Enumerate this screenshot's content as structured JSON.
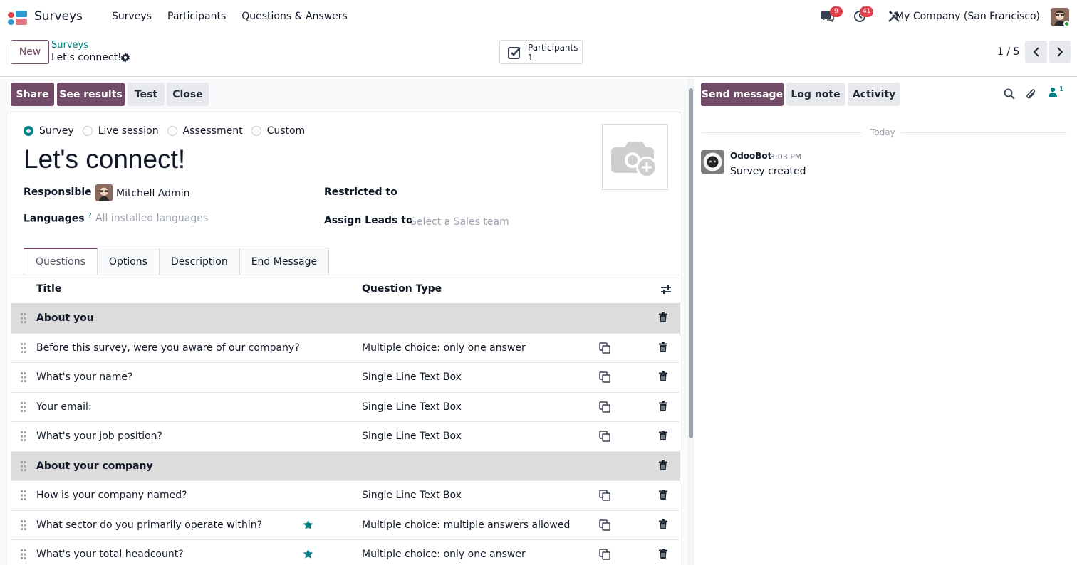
{
  "navbar": {
    "app_title": "Surveys",
    "menu": [
      "Surveys",
      "Participants",
      "Questions & Answers"
    ],
    "messages_count": "9",
    "activities_count": "41",
    "company": "My Company (San Francisco)"
  },
  "control": {
    "new_label": "New",
    "breadcrumb_parent": "Surveys",
    "breadcrumb_current": "Let's connect!",
    "smart_button": {
      "label": "Participants",
      "value": "1"
    },
    "pager": "1 / 5"
  },
  "header_buttons": {
    "share": "Share",
    "see_results": "See results",
    "test": "Test",
    "close": "Close"
  },
  "form": {
    "survey_types": [
      "Survey",
      "Live session",
      "Assessment",
      "Custom"
    ],
    "selected_type": "Survey",
    "title": "Let's connect!",
    "responsible_label": "Responsible",
    "responsible_value": "Mitchell Admin",
    "languages_label": "Languages",
    "languages_help": "?",
    "languages_placeholder": "All installed languages",
    "restricted_label": "Restricted to",
    "assign_leads_label": "Assign Leads to",
    "assign_leads_placeholder": "Select a Sales team"
  },
  "tabs": [
    "Questions",
    "Options",
    "Description",
    "End Message"
  ],
  "active_tab": "Questions",
  "table": {
    "columns": {
      "title": "Title",
      "type": "Question Type"
    },
    "rows": [
      {
        "title": "About you",
        "type": "",
        "section": true,
        "starred": false
      },
      {
        "title": "Before this survey, were you aware of our company?",
        "type": "Multiple choice: only one answer",
        "section": false,
        "starred": false
      },
      {
        "title": "What's your name?",
        "type": "Single Line Text Box",
        "section": false,
        "starred": false
      },
      {
        "title": "Your email:",
        "type": "Single Line Text Box",
        "section": false,
        "starred": false
      },
      {
        "title": "What's your job position?",
        "type": "Single Line Text Box",
        "section": false,
        "starred": false
      },
      {
        "title": "About your company",
        "type": "",
        "section": true,
        "starred": false
      },
      {
        "title": "How is your company named?",
        "type": "Single Line Text Box",
        "section": false,
        "starred": false
      },
      {
        "title": "What sector do you primarily operate within?",
        "type": "Multiple choice: multiple answers allowed",
        "section": false,
        "starred": true
      },
      {
        "title": "What's your total headcount?",
        "type": "Multiple choice: only one answer",
        "section": false,
        "starred": true
      }
    ]
  },
  "chatter": {
    "send_message": "Send message",
    "log_note": "Log note",
    "activity": "Activity",
    "followers_count": "1",
    "date_separator": "Today",
    "message": {
      "author": "OdooBot",
      "time": "3:03 PM",
      "body": "Survey created"
    }
  },
  "colors": {
    "brand": "#714b67",
    "accent": "#017e84",
    "badge": "#e3424d"
  },
  "icons": [
    "surveys-app-icon",
    "chat-icon",
    "clock-icon",
    "tools-icon",
    "gear-icon",
    "checkbox-icon",
    "chevron-left-icon",
    "chevron-right-icon",
    "camera-plus-icon",
    "sliders-icon",
    "drag-handle-icon",
    "star-icon",
    "copy-icon",
    "trash-icon",
    "search-icon",
    "paperclip-icon",
    "user-icon"
  ]
}
